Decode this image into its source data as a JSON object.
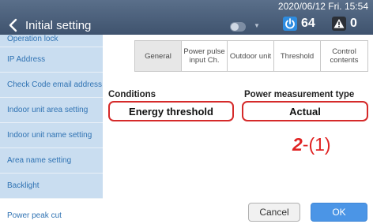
{
  "header": {
    "title": "Initial setting",
    "datetime": "2020/06/12 Fri. 15:54",
    "power_count": "64",
    "warning_count": "0"
  },
  "sidebar": {
    "items": [
      {
        "label": "Operation lock"
      },
      {
        "label": "IP Address"
      },
      {
        "label": "Check Code email address"
      },
      {
        "label": "Indoor unit area setting"
      },
      {
        "label": "Indoor unit name setting"
      },
      {
        "label": "Area name setting"
      },
      {
        "label": "Backlight"
      },
      {
        "label": "Power peak cut"
      }
    ]
  },
  "tabs": [
    {
      "label": "General"
    },
    {
      "label": "Power pulse input Ch."
    },
    {
      "label": "Outdoor unit"
    },
    {
      "label": "Threshold"
    },
    {
      "label": "Control contents"
    }
  ],
  "conditions": {
    "label": "Conditions",
    "value": "Energy threshold"
  },
  "power_measurement": {
    "label": "Power measurement type",
    "value": "Actual"
  },
  "annotation": {
    "number": "2",
    "suffix": "-(1)"
  },
  "buttons": {
    "cancel": "Cancel",
    "ok": "OK"
  },
  "colors": {
    "header": "#4a5e7a",
    "sidebar": "#c9ddf0",
    "highlight": "#d52a2a",
    "ok_button": "#4b95e6"
  }
}
